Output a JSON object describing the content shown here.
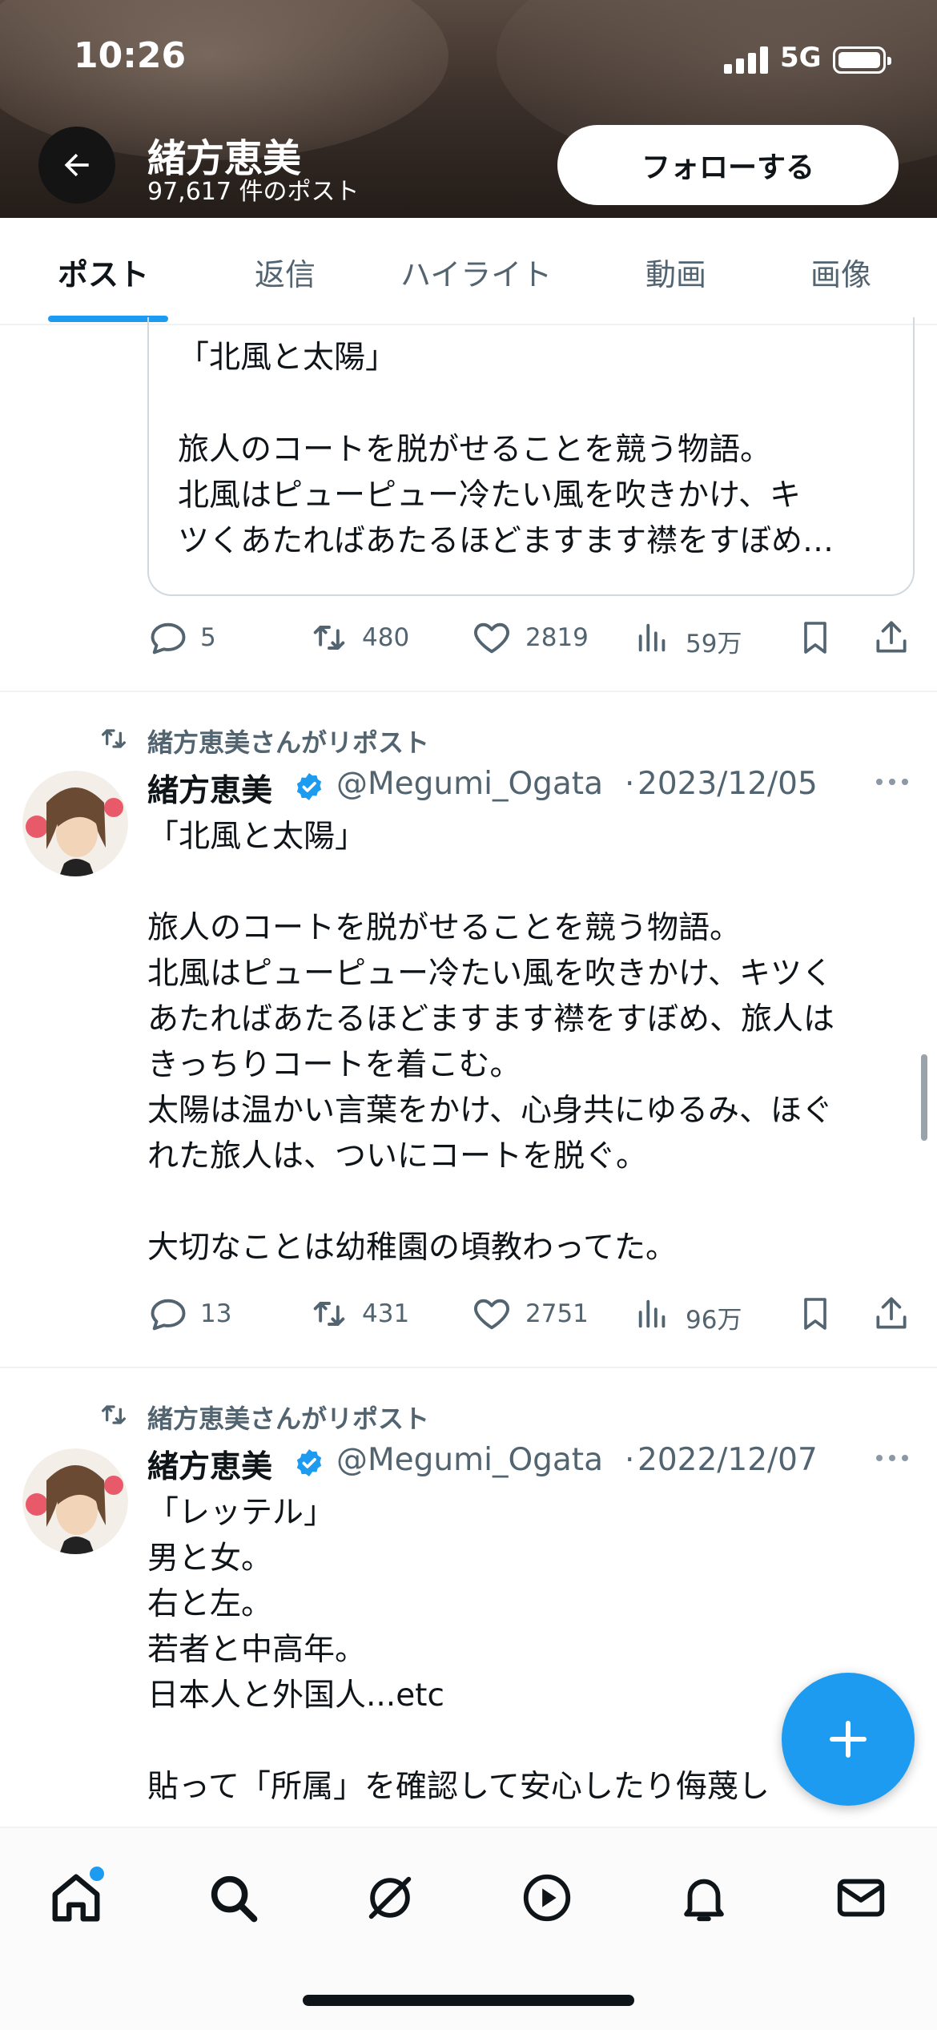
{
  "status_bar": {
    "time": "10:26",
    "network": "5G"
  },
  "header": {
    "name": "緒方恵美",
    "post_count": "97,617 件のポスト",
    "follow_label": "フォローする"
  },
  "tabs": [
    "ポスト",
    "返信",
    "ハイライト",
    "動画",
    "画像"
  ],
  "quoted_card": {
    "title": "「北風と太陽」",
    "line1": "旅人のコートを脱がせることを競う物語。",
    "line2": "北風はピューピュー冷たい風を吹きかけ、キ",
    "line3": "ツくあたればあたるほどますます襟をすぼめ…"
  },
  "stats_row_1": {
    "replies": "5",
    "reposts": "480",
    "likes": "2819",
    "views": "59万"
  },
  "posts": [
    {
      "repost_label": "緒方恵美さんがリポスト",
      "name": "緒方恵美",
      "handle": "@Megumi_Ogata",
      "date": "2023/12/05",
      "body": "「北風と太陽」\n\n旅人のコートを脱がせることを競う物語。\n北風はピューピュー冷たい風を吹きかけ、キツく\nあたればあたるほどますます襟をすぼめ、旅人は\nきっちりコートを着こむ。\n太陽は温かい言葉をかけ、心身共にゆるみ、ほぐ\nれた旅人は、ついにコートを脱ぐ。\n\n大切なことは幼稚園の頃教わってた。",
      "replies": "13",
      "reposts": "431",
      "likes": "2751",
      "views": "96万"
    },
    {
      "repost_label": "緒方恵美さんがリポスト",
      "name": "緒方恵美",
      "handle": "@Megumi_Ogata",
      "date": "2022/12/07",
      "body": "「レッテル」\n男と女。\n右と左。\n若者と中高年。\n日本人と外国人...etc\n\n貼って「所属」を確認して安心したり侮蔑し"
    }
  ],
  "icons": {
    "back": "arrow-left-icon",
    "reply": "reply-icon",
    "repost": "repost-icon",
    "like": "heart-icon",
    "views": "views-icon",
    "bookmark": "bookmark-icon",
    "share": "share-icon",
    "more": "more-icon",
    "verified": "verified-badge-icon",
    "compose": "plus-icon",
    "nav": [
      "home-icon",
      "search-icon",
      "grok-icon",
      "video-icon",
      "notifications-icon",
      "messages-icon"
    ]
  },
  "colors": {
    "accent": "#1d9bf0",
    "text": "#0f1419",
    "secondary": "#536471"
  }
}
